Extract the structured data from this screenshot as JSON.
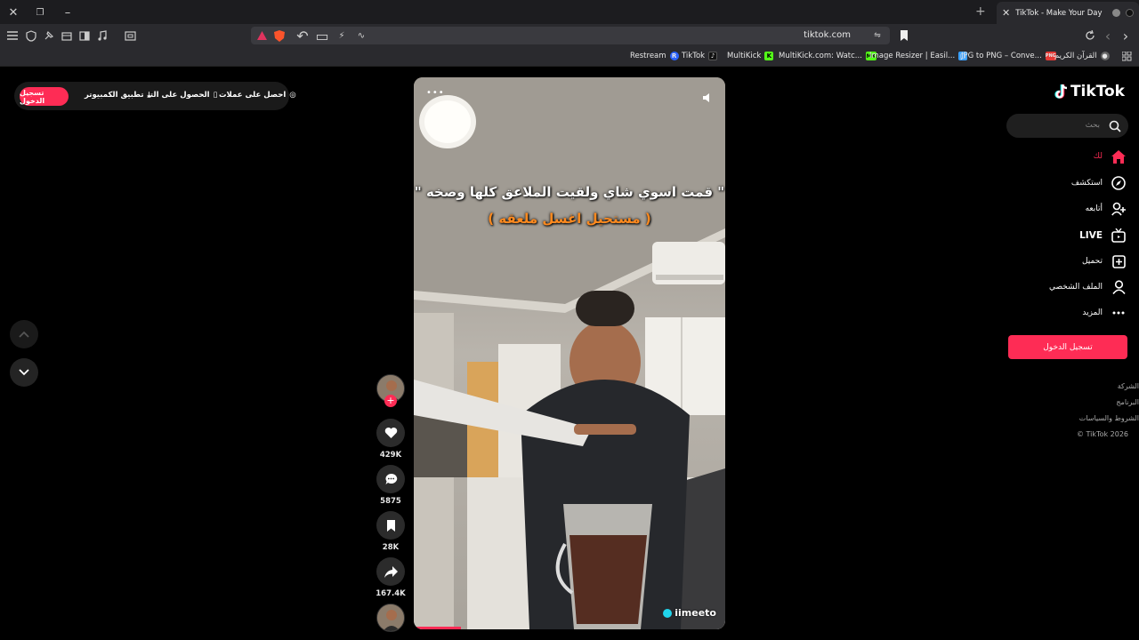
{
  "browser": {
    "tab_title": "TikTok - Make Your Day",
    "url": "tiktok.com",
    "bookmarks": [
      {
        "label": "Restream",
        "fav": "R",
        "color": "#2b63ff"
      },
      {
        "label": "TikTok",
        "fav": "♪",
        "color": "#111"
      },
      {
        "label": "MultiKick",
        "fav": "K",
        "color": "#53fc18"
      },
      {
        "label": "MultiKick.com: Watc...",
        "fav": "MK",
        "color": "#53fc18"
      },
      {
        "label": "Image Resizer | Easil...",
        "fav": "▢",
        "color": "#3aa0ff"
      },
      {
        "label": "JPG to PNG – Conve...",
        "fav": "PNG",
        "color": "#e53935"
      },
      {
        "label": "القرآن الكريم",
        "fav": "●",
        "color": "#666"
      }
    ]
  },
  "topbar": {
    "login": "تسجيل الدخول",
    "desktop_app": "تطبيق الكمبيوتر",
    "get_app": "الحصول على التـ",
    "get_coins": "احصل على عملات"
  },
  "video": {
    "caption_line1": "\" قمت اسوي شاي ولقيت الملاعق كلها وصخه \"",
    "caption_line2": "( مستحيل اغسل ملعقه )",
    "watermark": "iimeeto",
    "more": "•••",
    "progress": 0.15
  },
  "actions": {
    "likes": "429K",
    "comments": "5875",
    "saves": "28K",
    "shares": "167.4K"
  },
  "sidebar": {
    "logo": "TikTok",
    "search_placeholder": "بحث",
    "items": [
      {
        "label": "لك",
        "icon": "home-icon",
        "active": true
      },
      {
        "label": "استكشف",
        "icon": "compass-icon"
      },
      {
        "label": "أتابعه",
        "icon": "follow-icon"
      },
      {
        "label": "LIVE",
        "icon": "live-icon"
      },
      {
        "label": "تحميل",
        "icon": "upload-icon"
      },
      {
        "label": "الملف الشخصي",
        "icon": "profile-icon"
      },
      {
        "label": "المزيد",
        "icon": "more-icon"
      }
    ],
    "login_button": "تسجيل الدخول",
    "footer": [
      "الشركة",
      "البرنامج",
      "الشروط والسياسات",
      "© TikTok 2026"
    ]
  },
  "colors": {
    "accent": "#fe2c55",
    "background": "#000000"
  }
}
